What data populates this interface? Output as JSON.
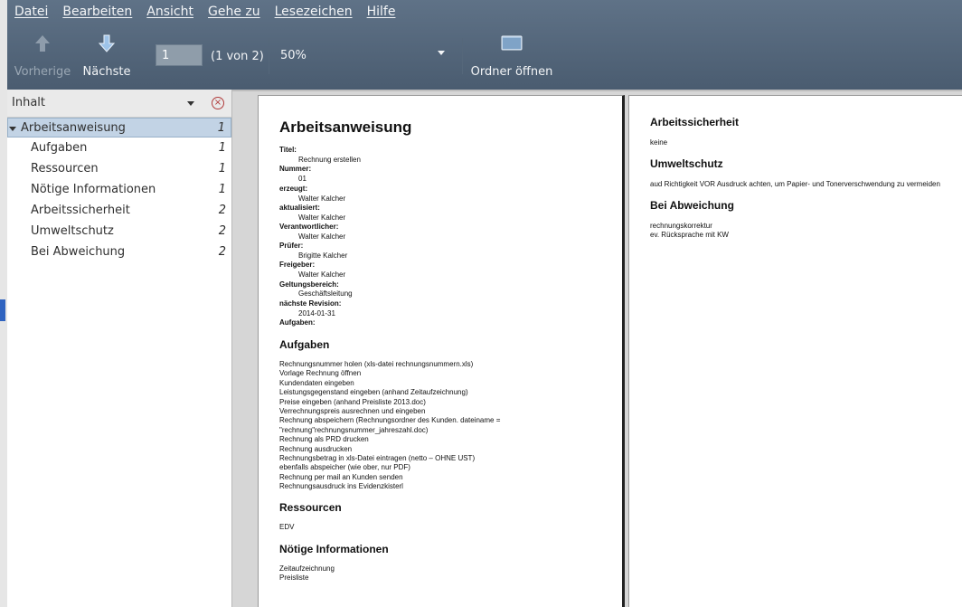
{
  "menu": [
    "Datei",
    "Bearbeiten",
    "Ansicht",
    "Gehe zu",
    "Lesezeichen",
    "Hilfe"
  ],
  "toolbar": {
    "prev_label": "Vorherige",
    "next_label": "Nächste",
    "page_value": "1",
    "page_of": "(1 von 2)",
    "zoom": "50%",
    "folder_label": "Ordner öffnen"
  },
  "sidebar": {
    "title": "Inhalt",
    "items": [
      {
        "label": "Arbeitsanweisung",
        "page": "1"
      },
      {
        "label": "Aufgaben",
        "page": "1"
      },
      {
        "label": "Ressourcen",
        "page": "1"
      },
      {
        "label": "Nötige Informationen",
        "page": "1"
      },
      {
        "label": "Arbeitssicherheit",
        "page": "2"
      },
      {
        "label": "Umweltschutz",
        "page": "2"
      },
      {
        "label": "Bei Abweichung",
        "page": "2"
      }
    ]
  },
  "page1": {
    "title": "Arbeitsanweisung",
    "fields": [
      {
        "label": "Titel:",
        "value": "Rechnung erstellen"
      },
      {
        "label": "Nummer:",
        "value": "01"
      },
      {
        "label": "erzeugt:",
        "value": "Walter Kalcher"
      },
      {
        "label": "aktualisiert:",
        "value": "Walter Kalcher"
      },
      {
        "label": "Verantwortlicher:",
        "value": "Walter Kalcher"
      },
      {
        "label": "Prüfer:",
        "value": "Brigitte Kalcher"
      },
      {
        "label": "Freigeber:",
        "value": "Walter Kalcher"
      },
      {
        "label": "Geltungsbereich:",
        "value": "Geschäftsleitung"
      },
      {
        "label": "nächste Revision:",
        "value": "2014-01-31"
      },
      {
        "label": "Aufgaben:",
        "value": ""
      }
    ],
    "aufgaben_title": "Aufgaben",
    "aufgaben_lines": [
      "Rechnungsnummer holen (xls-datei rechnungsnummern.xls)",
      "Vorlage Rechnung öffnen",
      "Kundendaten eingeben",
      "Leistungsgegenstand eingeben (anhand Zeitaufzeichnung)",
      "Preise eingeben (anhand Preisliste 2013.doc)",
      "Verrechnungspreis ausrechnen und eingeben",
      "Rechnung abspeichern (Rechnungsordner des Kunden. dateiname =",
      "\"rechnung\"rechnungsnummer_jahreszahl.doc)",
      "Rechnung als PRD drucken",
      "Rechnung ausdrucken",
      "Rechnungsbetrag in xls-Datei eintragen (netto – OHNE UST)",
      "ebenfalls abspeicher (wie ober, nur PDF)",
      "Rechnung per mail an Kunden senden",
      "Rechnungsausdruck ins Evidenzkisterl"
    ],
    "ressourcen_title": "Ressourcen",
    "ressourcen_lines": [
      "EDV"
    ],
    "info_title": "Nötige Informationen",
    "info_lines": [
      "Zeitaufzeichnung",
      "Preisliste"
    ]
  },
  "page2": {
    "s1_title": "Arbeitssicherheit",
    "s1_text": "keine",
    "s2_title": "Umweltschutz",
    "s2_text": "aud Richtigkeit VOR Ausdruck achten, um Papier- und Tonerverschwendung zu vermeiden",
    "s3_title": "Bei Abweichung",
    "s3_lines": [
      "rechnungskorrektur",
      "ev. Rücksprache mit KW"
    ]
  }
}
